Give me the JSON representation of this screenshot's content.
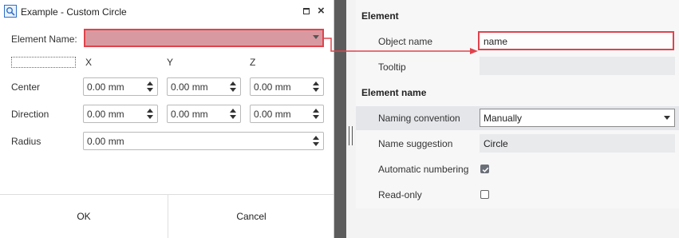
{
  "dialog": {
    "title": "Example - Custom Circle",
    "element_name_label": "Element Name:",
    "element_name_value": "",
    "axis_labels": [
      "X",
      "Y",
      "Z"
    ],
    "rows": [
      {
        "label": "Center",
        "values": [
          "0.00 mm",
          "0.00 mm",
          "0.00 mm"
        ]
      },
      {
        "label": "Direction",
        "values": [
          "0.00 mm",
          "0.00 mm",
          "0.00 mm"
        ]
      }
    ],
    "radius": {
      "label": "Radius",
      "value": "0.00 mm"
    },
    "ok_label": "OK",
    "cancel_label": "Cancel"
  },
  "properties": {
    "element_section": "Element",
    "object_name_label": "Object name",
    "object_name_value": "name",
    "tooltip_label": "Tooltip",
    "tooltip_value": "",
    "element_name_section": "Element name",
    "naming_convention_label": "Naming convention",
    "naming_convention_value": "Manually",
    "name_suggestion_label": "Name suggestion",
    "name_suggestion_value": "Circle",
    "automatic_numbering_label": "Automatic numbering",
    "automatic_numbering_checked": true,
    "read_only_label": "Read-only",
    "read_only_checked": false
  },
  "colors": {
    "highlight_red": "#e0434c",
    "element_name_fill": "#d89aa0",
    "splitter": "#5c5c5c"
  }
}
